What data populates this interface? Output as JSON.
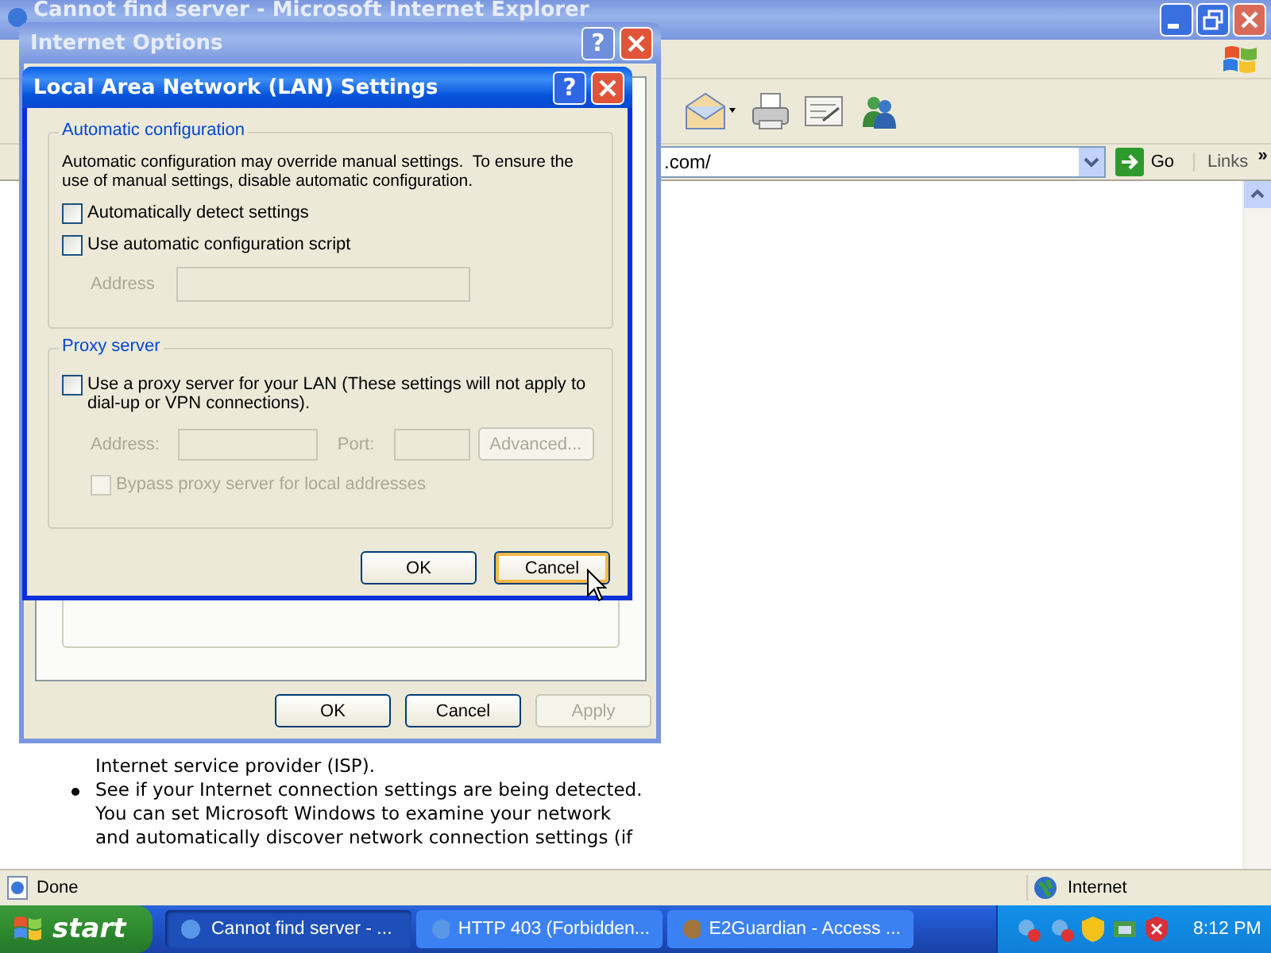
{
  "browser": {
    "title": "Cannot find server - Microsoft Internet Explorer",
    "address": ".com/",
    "go": "Go",
    "links": "Links",
    "links_more": "»",
    "content": [
      {
        "kind": "continuation",
        "text": "Internet service provider (ISP)."
      },
      {
        "kind": "bullet",
        "text": "See if your Internet connection settings are being detected. You can set Microsoft Windows to examine your network and automatically discover network connection settings (if"
      }
    ],
    "status": "Done",
    "zone": "Internet"
  },
  "internet_options": {
    "title": "Internet Options",
    "help": "?",
    "buttons": [
      {
        "label": "OK",
        "disabled": false
      },
      {
        "label": "Cancel",
        "disabled": false
      },
      {
        "label": "Apply",
        "disabled": true
      }
    ]
  },
  "lan_dialog": {
    "title": "Local Area Network (LAN) Settings",
    "help": "?",
    "auto_group": {
      "title": "Automatic configuration",
      "description": "Automatic configuration may override manual settings.  To ensure the use of manual settings, disable automatic configuration.",
      "options": [
        {
          "label": "Automatically detect settings",
          "checked": false
        },
        {
          "label": "Use automatic configuration script",
          "checked": false
        }
      ],
      "address": {
        "label": "Address",
        "disabled": true
      }
    },
    "proxy_group": {
      "title": "Proxy server",
      "option": {
        "label": "Use a proxy server for your LAN (These settings will not apply to dial-up or VPN connections).",
        "checked": false
      },
      "fields": [
        {
          "label": "Address:",
          "disabled": true
        },
        {
          "label": "Port:",
          "disabled": true
        }
      ],
      "advanced": {
        "label": "Advanced...",
        "disabled": true
      },
      "bypass": {
        "label": "Bypass proxy server for local addresses",
        "checked": false,
        "disabled": true
      }
    },
    "buttons": [
      {
        "label": "OK",
        "focused": false
      },
      {
        "label": "Cancel",
        "focused": true
      }
    ]
  },
  "taskbar": {
    "start": "start",
    "tasks": [
      {
        "label": "Cannot find server - ...",
        "selected": true
      },
      {
        "label": "HTTP 403 (Forbidden...",
        "selected": false
      },
      {
        "label": "E2Guardian - Access ...",
        "selected": false
      }
    ],
    "clock": "8:12 PM"
  }
}
